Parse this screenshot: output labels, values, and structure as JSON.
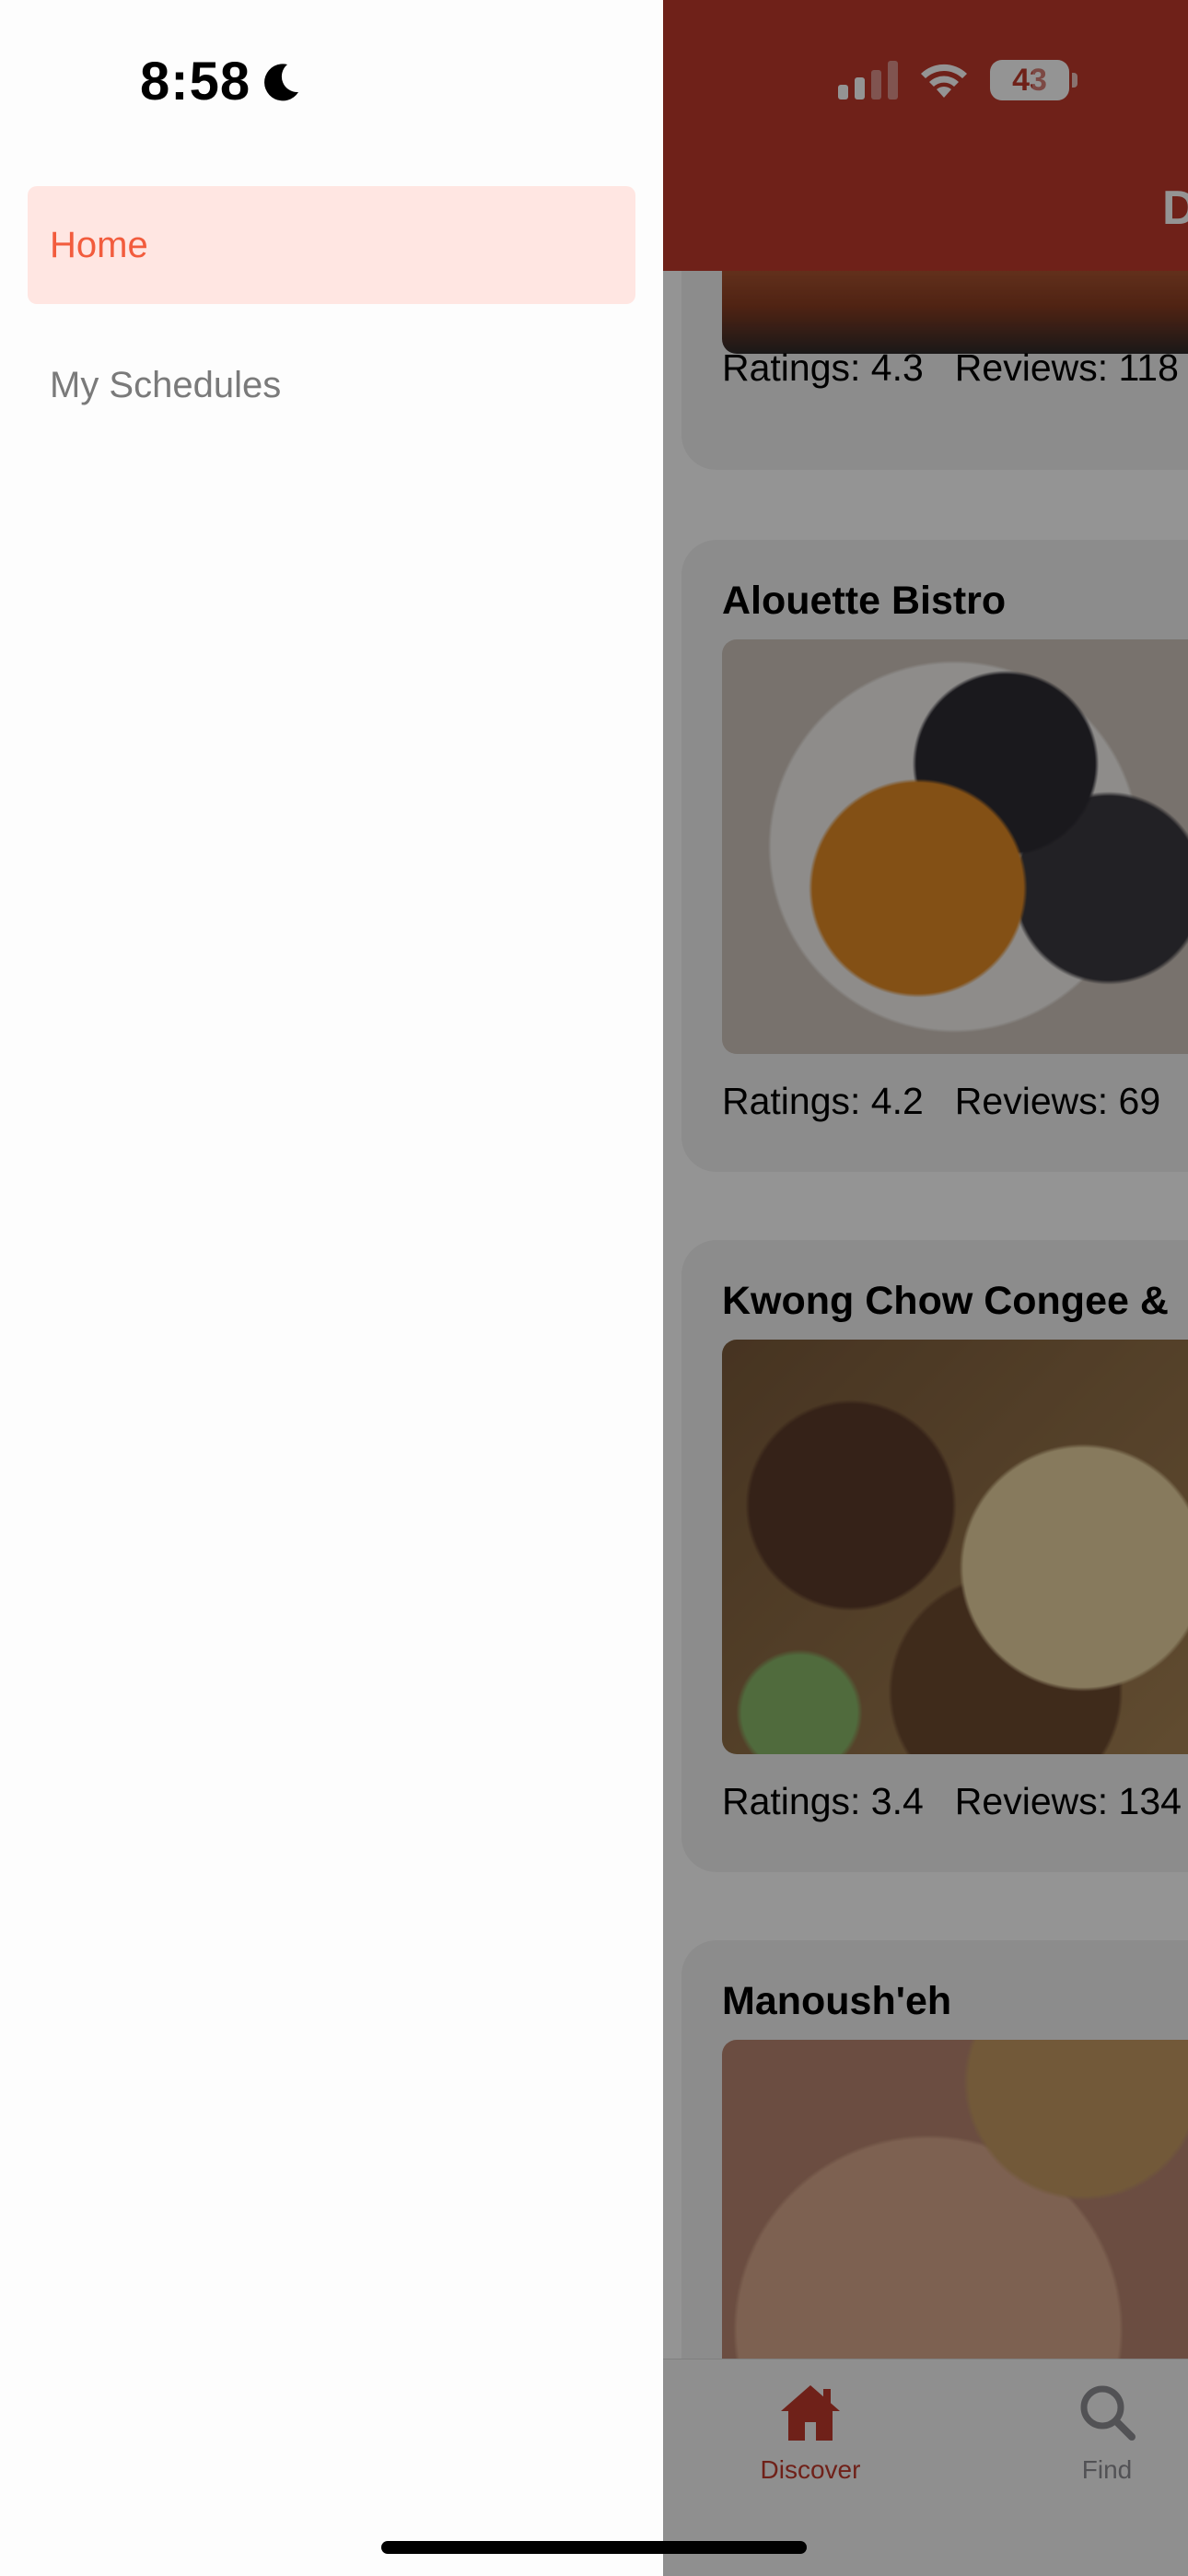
{
  "status_bar": {
    "time": "8:58",
    "battery_level": "43",
    "signal_bars": 2,
    "focus_icon": "moon-icon"
  },
  "drawer": {
    "items": [
      {
        "label": "Home",
        "active": true
      },
      {
        "label": "My Schedules",
        "active": false
      }
    ]
  },
  "app": {
    "header": {
      "title": "D"
    },
    "cards": [
      {
        "title": "",
        "ratings": "Ratings: 4.3",
        "reviews": "Reviews: 118"
      },
      {
        "title": "Alouette Bistro",
        "ratings": "Ratings: 4.2",
        "reviews": "Reviews: 69"
      },
      {
        "title": "Kwong Chow Congee &",
        "ratings": "Ratings: 3.4",
        "reviews": "Reviews: 134"
      },
      {
        "title": "Manoush'eh",
        "ratings": "",
        "reviews": ""
      }
    ],
    "tabs": [
      {
        "label": "Discover",
        "icon": "house-icon",
        "active": true
      },
      {
        "label": "Find",
        "icon": "search-icon",
        "active": false
      }
    ]
  },
  "colors": {
    "brand": "#c0392b",
    "drawer_active_bg": "#ffe6e2",
    "drawer_active_text": "#f25c3d",
    "drawer_inactive_text": "#7a7a7a"
  }
}
